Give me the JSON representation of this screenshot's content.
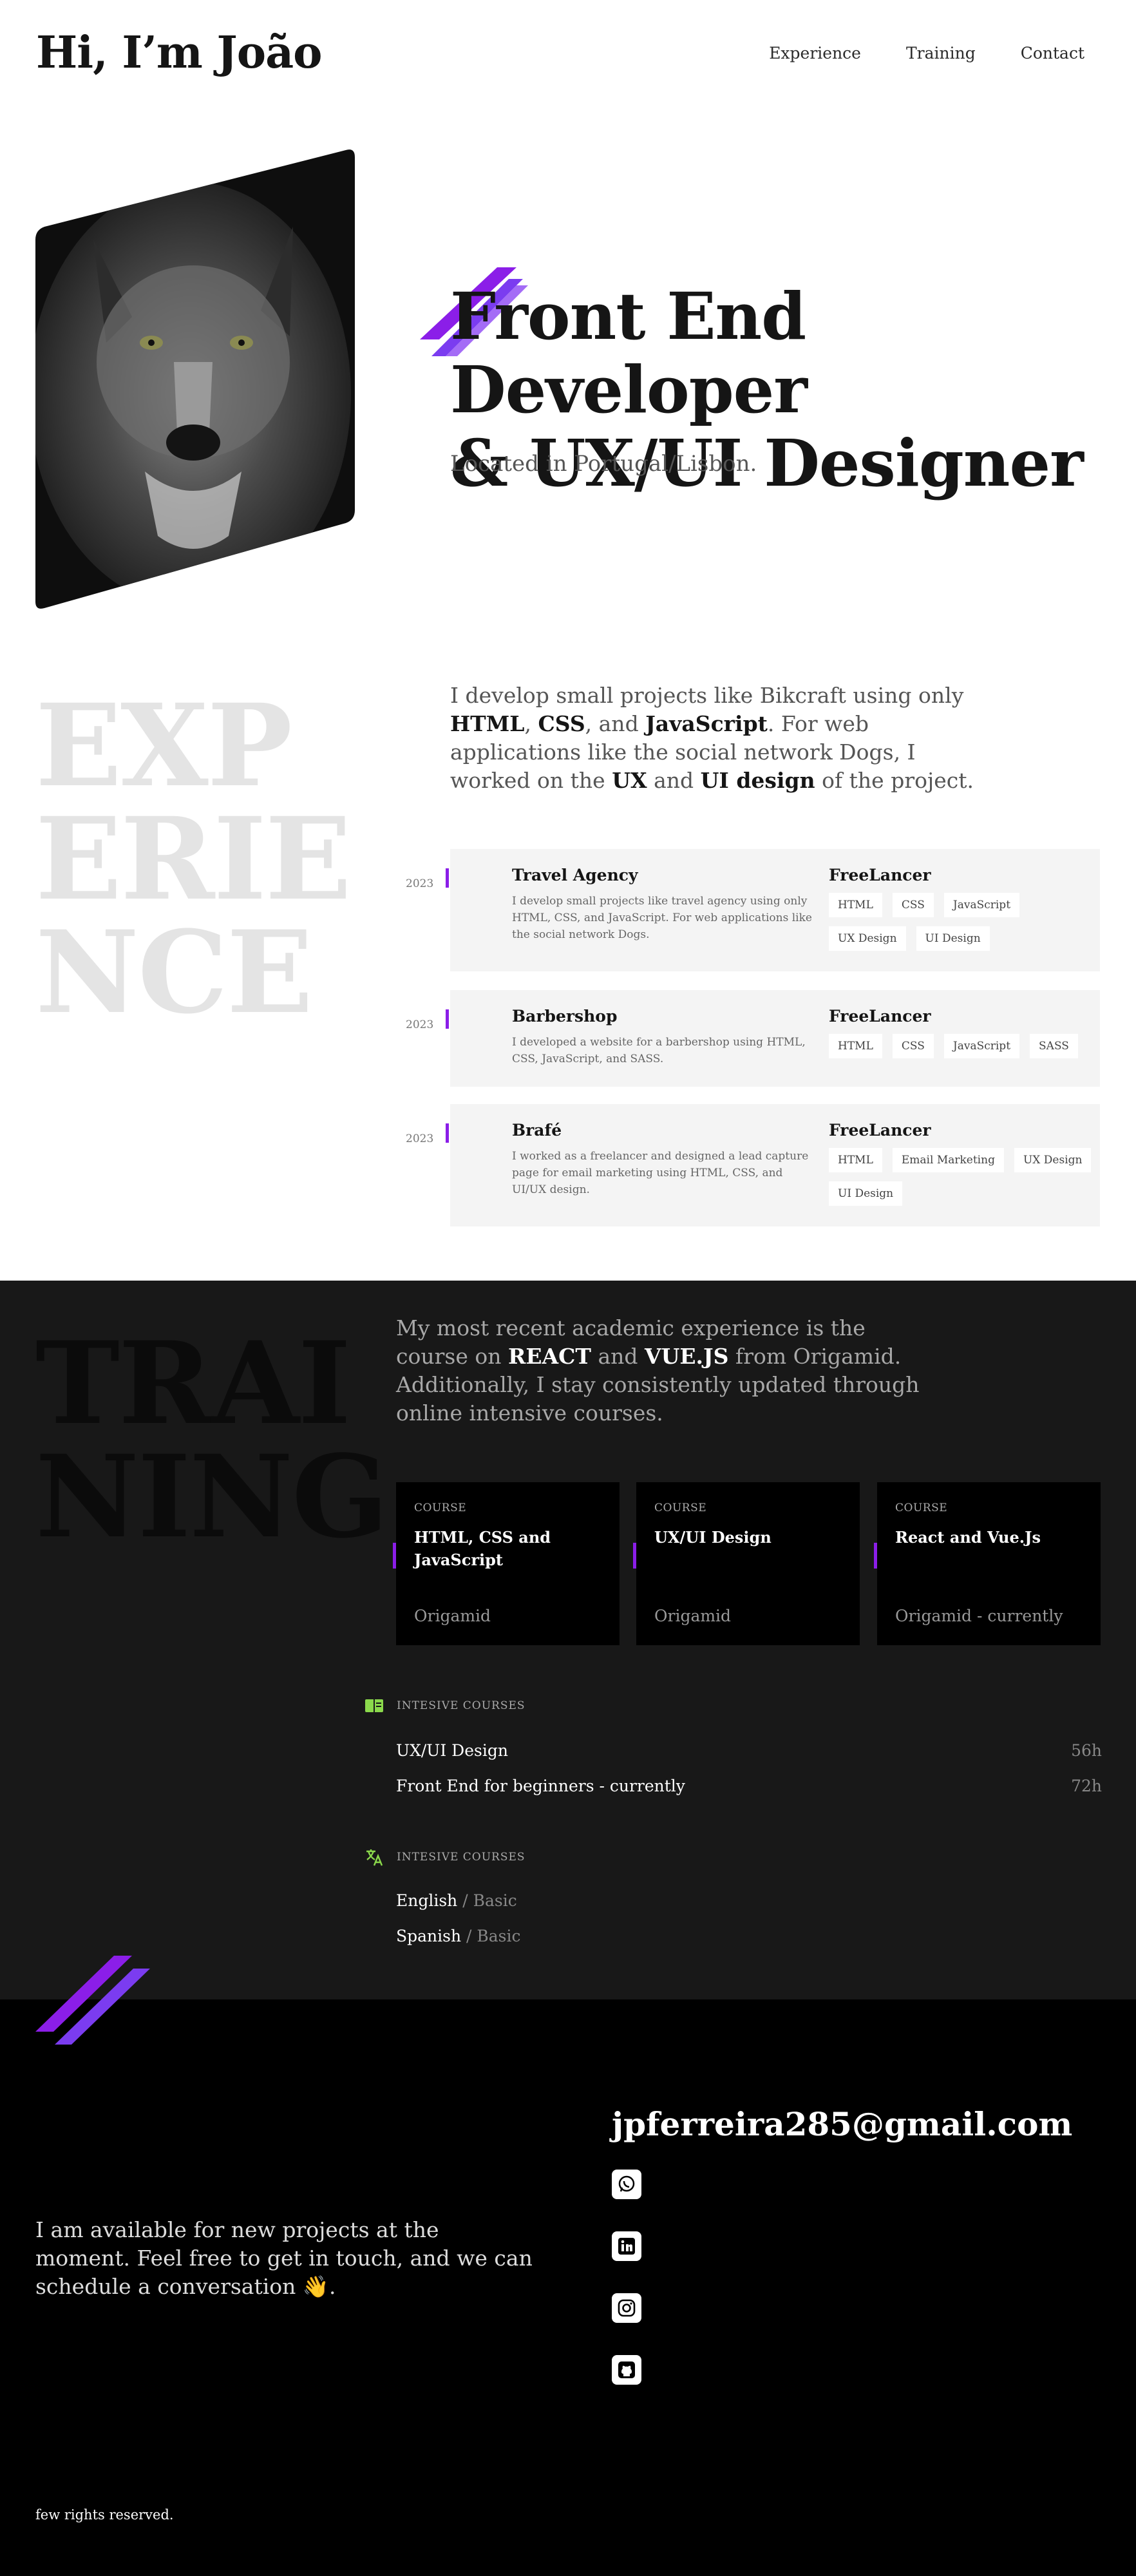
{
  "header": {
    "logo": "Hi, I’m João",
    "nav": [
      "Experience",
      "Training",
      "Contact"
    ]
  },
  "hero": {
    "title_line1": "Front End Developer",
    "title_line2": "& UX/UI Designer",
    "location": "Located in Portugal/Lisbon."
  },
  "experience": {
    "title_lines": [
      "EXP",
      "ERIE",
      "NCE"
    ],
    "intro": {
      "p1": "I develop small projects like Bikcraft using only ",
      "b1": "HTML",
      "p2": ", ",
      "b2": "CSS",
      "p3": ", and ",
      "b3": "JavaScript",
      "p4": ". For web applications like the social network Dogs, I worked on the ",
      "b4": "UX",
      "p5": " and ",
      "b5": "UI design",
      "p6": " of the project."
    },
    "items": [
      {
        "year": "2023",
        "name": "Travel Agency",
        "desc": "I develop small projects like travel agency using only HTML, CSS, and JavaScript. For web applications like the social network Dogs.",
        "role": "FreeLancer",
        "tags": [
          "HTML",
          "CSS",
          "JavaScript",
          "UX Design",
          "UI Design"
        ]
      },
      {
        "year": "2023",
        "name": "Barbershop",
        "desc": "I developed a website for a barbershop using HTML, CSS, JavaScript, and SASS.",
        "role": "FreeLancer",
        "tags": [
          "HTML",
          "CSS",
          "JavaScript",
          "SASS"
        ]
      },
      {
        "year": "2023",
        "name": "Brafé",
        "desc": "I worked as a freelancer and designed a lead capture page for email marketing using HTML, CSS, and UI/UX design.",
        "role": "FreeLancer",
        "tags": [
          "HTML",
          "Email Marketing",
          "UX Design",
          "UI Design"
        ]
      }
    ]
  },
  "training": {
    "title_lines": [
      "TRAI",
      "NING"
    ],
    "intro": {
      "p1": "My most recent academic experience is the course on ",
      "b1": "REACT",
      "p2": " and ",
      "b2": "VUE.JS",
      "p3": " from Origamid. Additionally, I stay consistently updated through online intensive courses."
    },
    "courses": [
      {
        "label": "COURSE",
        "name": "HTML, CSS and JavaScript",
        "school": "Origamid"
      },
      {
        "label": "COURSE",
        "name": "UX/UI Design",
        "school": "Origamid"
      },
      {
        "label": "COURSE",
        "name": "React and Vue.Js",
        "school": "Origamid - currently"
      }
    ],
    "intensive": {
      "label": "INTESIVE COURSES",
      "items": [
        {
          "name": "UX/UI Design",
          "duration": "56h"
        },
        {
          "name": "Front End for beginners - currently",
          "duration": "72h"
        }
      ]
    },
    "languages": {
      "label": "INTESIVE COURSES",
      "items": [
        {
          "name": "English",
          "sep": " / ",
          "level": "Basic"
        },
        {
          "name": "Spanish",
          "sep": " / ",
          "level": "Basic"
        }
      ]
    }
  },
  "contact": {
    "text": "I am available for new projects at the moment. Feel free to get in touch, and we can schedule a conversation 👋.",
    "email": "jpferreira285@gmail.com",
    "social_icons": [
      "whatsapp-icon",
      "linkedin-icon",
      "instagram-icon",
      "github-icon"
    ],
    "footer": "few rights reserved."
  },
  "colors": {
    "accent": "#8b1ee8",
    "accent_light": "#7b3cf0",
    "green": "#8bd94c",
    "dark_bg": "#181818",
    "black_bg": "#000000"
  }
}
